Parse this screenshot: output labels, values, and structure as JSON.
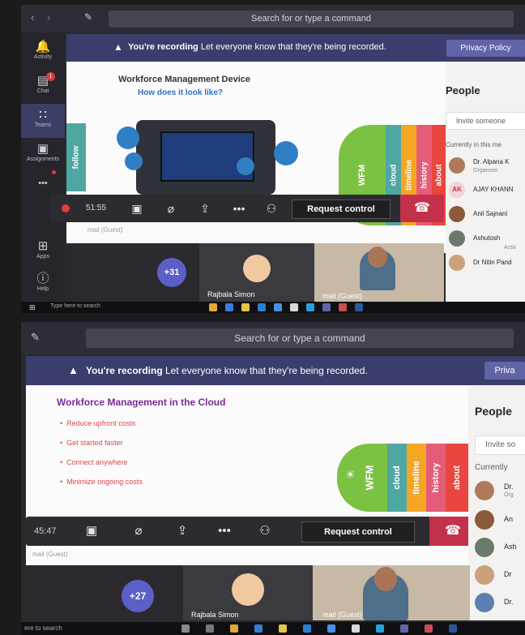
{
  "shot1": {
    "search_placeholder": "Search for or type a command",
    "rail": [
      {
        "label": "Activity",
        "icon": "bell-icon",
        "glyph": "🔔"
      },
      {
        "label": "Chat",
        "icon": "chat-icon",
        "glyph": "💬",
        "badge": "1"
      },
      {
        "label": "Teams",
        "icon": "teams-icon",
        "glyph": "👥"
      },
      {
        "label": "Assignments",
        "icon": "assignments-icon",
        "glyph": "📋"
      },
      {
        "label": "...",
        "icon": "more-icon",
        "glyph": "•••"
      },
      {
        "label": "Apps",
        "icon": "apps-icon",
        "glyph": "⊞"
      },
      {
        "label": "Help",
        "icon": "help-icon",
        "glyph": "?"
      }
    ],
    "recording": {
      "bold": "You're recording",
      "text": "Let everyone know that they're being recorded.",
      "privacy": "Privacy Policy"
    },
    "slide": {
      "title": "Workforce Management Device",
      "subtitle": "How does it look like?",
      "tabs": [
        "follow",
        "WFM",
        "cloud",
        "timeline",
        "history",
        "about"
      ]
    },
    "controls": {
      "timer": "51:55",
      "request": "Request control"
    },
    "guest_label": "mail (Guest)",
    "people": {
      "title": "People",
      "invite": "Invite someone",
      "section": "Currently in this me",
      "members": [
        {
          "name": "Dr. Alpana K",
          "role": "Organiser",
          "initials": ""
        },
        {
          "name": "AJAY KHANN",
          "role": "",
          "initials": "AK"
        },
        {
          "name": "Anil Sajnani",
          "role": "",
          "initials": ""
        },
        {
          "name": "Ashutosh",
          "role": "",
          "initials": ""
        },
        {
          "name": "Dr Nitin Pand",
          "role": "",
          "initials": ""
        }
      ],
      "activ": "Activ"
    },
    "tiles": {
      "count": "+31",
      "person1": "Rajbala Simon",
      "person2": "mail (Guest)"
    },
    "taskbar_search": "Type here to search"
  },
  "shot2": {
    "search_placeholder": "Search for or type a command",
    "recording": {
      "bold": "You're recording",
      "text": "Let everyone know that they're being recorded.",
      "privacy": "Priva"
    },
    "slide": {
      "title": "Workforce Management in the Cloud",
      "bullets": [
        "Reduce upfront costs",
        "Get started faster",
        "Connect anywhere",
        "Minimize ongoing costs"
      ],
      "tabs": [
        "WFM",
        "cloud",
        "timeline",
        "history",
        "about"
      ]
    },
    "controls": {
      "timer": "45:47",
      "request": "Request control"
    },
    "guest_label": "mail (Guest)",
    "people": {
      "title": "People",
      "invite": "Invite so",
      "section": "Currently",
      "members": [
        {
          "name": "Dr.",
          "role": "Org"
        },
        {
          "name": "An",
          "role": ""
        },
        {
          "name": "Ash",
          "role": ""
        },
        {
          "name": "Dr",
          "role": ""
        },
        {
          "name": "Dr.",
          "role": ""
        }
      ]
    },
    "tiles": {
      "count": "+27",
      "person1": "Rajbala Simon",
      "person2": "mail (Guest)"
    },
    "taskbar_search": "ere to search"
  },
  "colors": {
    "accent": "#6264a7",
    "recbar": "#3b3d6c",
    "hangup": "#c4314b",
    "tab_green": "#7cc242",
    "tab_teal": "#4fa7a3",
    "tab_orange": "#f5a623",
    "tab_pink": "#e45c78",
    "tab_red": "#e8463f"
  }
}
